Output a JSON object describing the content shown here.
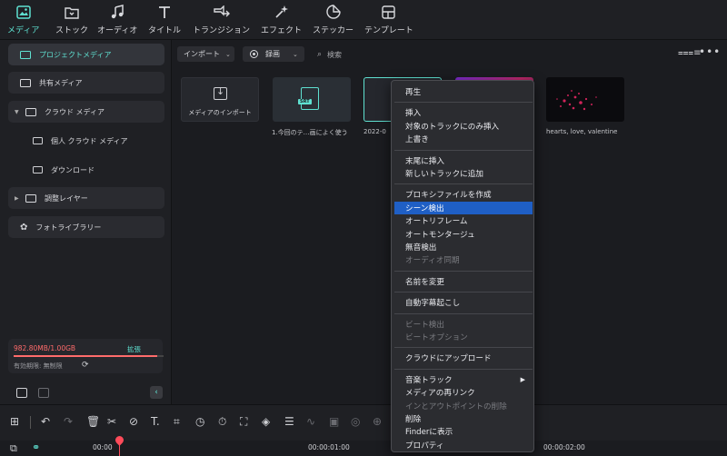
{
  "toolbar": {
    "items": [
      {
        "label": "メディア",
        "icon": "media-icon",
        "active": true
      },
      {
        "label": "ストック",
        "icon": "stock-icon"
      },
      {
        "label": "オーディオ",
        "icon": "music-note-icon"
      },
      {
        "label": "タイトル",
        "icon": "title-t-icon"
      },
      {
        "label": "トランジション",
        "icon": "transition-icon"
      },
      {
        "label": "エフェクト",
        "icon": "effect-sparkle-icon"
      },
      {
        "label": "ステッカー",
        "icon": "sticker-icon"
      },
      {
        "label": "テンプレート",
        "icon": "template-icon"
      }
    ]
  },
  "sidebar": {
    "items": [
      {
        "label": "プロジェクトメディア",
        "active": true
      },
      {
        "label": "共有メディア"
      },
      {
        "label": "クラウド メディア",
        "expanded": true
      },
      {
        "label": "個人 クラウド メディア"
      },
      {
        "label": "ダウンロード"
      },
      {
        "label": "調整レイヤー"
      },
      {
        "label": "フォトライブラリー"
      }
    ],
    "storage": {
      "used": "982.80MB/1.00GB",
      "used_fraction": 0.96,
      "expand": "拡張",
      "expiry": "有効期限: 無制限"
    }
  },
  "media": {
    "import_button": "インポート",
    "record_button": "録画",
    "search_placeholder": "検索",
    "import_tile": "メディアのインポート",
    "srt_tag": "SRT",
    "items": [
      {
        "label": "1.今回のテ…画によく使う"
      },
      {
        "label": "2022-0"
      },
      {
        "label": ""
      },
      {
        "label": "hearts, love, valentine"
      }
    ]
  },
  "context_menu": {
    "items": [
      {
        "label": "再生"
      },
      {
        "label": "挿入"
      },
      {
        "label": "対象のトラックにのみ挿入"
      },
      {
        "label": "上書き"
      },
      {
        "label": "末尾に挿入"
      },
      {
        "label": "新しいトラックに追加"
      },
      {
        "label": "プロキシファイルを作成"
      },
      {
        "label": "シーン検出",
        "highlighted": true
      },
      {
        "label": "オートリフレーム"
      },
      {
        "label": "オートモンタージュ"
      },
      {
        "label": "無音検出"
      },
      {
        "label": "オーディオ同期",
        "disabled": true
      },
      {
        "label": "名前を変更"
      },
      {
        "label": "自動字幕起こし"
      },
      {
        "label": "ビート検出",
        "disabled": true
      },
      {
        "label": "ビートオプション",
        "disabled": true
      },
      {
        "label": "クラウドにアップロード"
      },
      {
        "label": "音楽トラック",
        "submenu": true
      },
      {
        "label": "メディアの再リンク"
      },
      {
        "label": "インとアウトポイントの削除",
        "disabled": true
      },
      {
        "label": "削除"
      },
      {
        "label": "Finderに表示"
      },
      {
        "label": "プロパティ"
      }
    ]
  },
  "timeline": {
    "timecodes": [
      "00:00",
      "00:00:01:00",
      "00:00:02:00"
    ]
  },
  "colors": {
    "accent": "#5fe1d1",
    "highlight": "#1f5fc5",
    "warning": "#ff6b6b",
    "playhead": "#ff4b5a"
  }
}
